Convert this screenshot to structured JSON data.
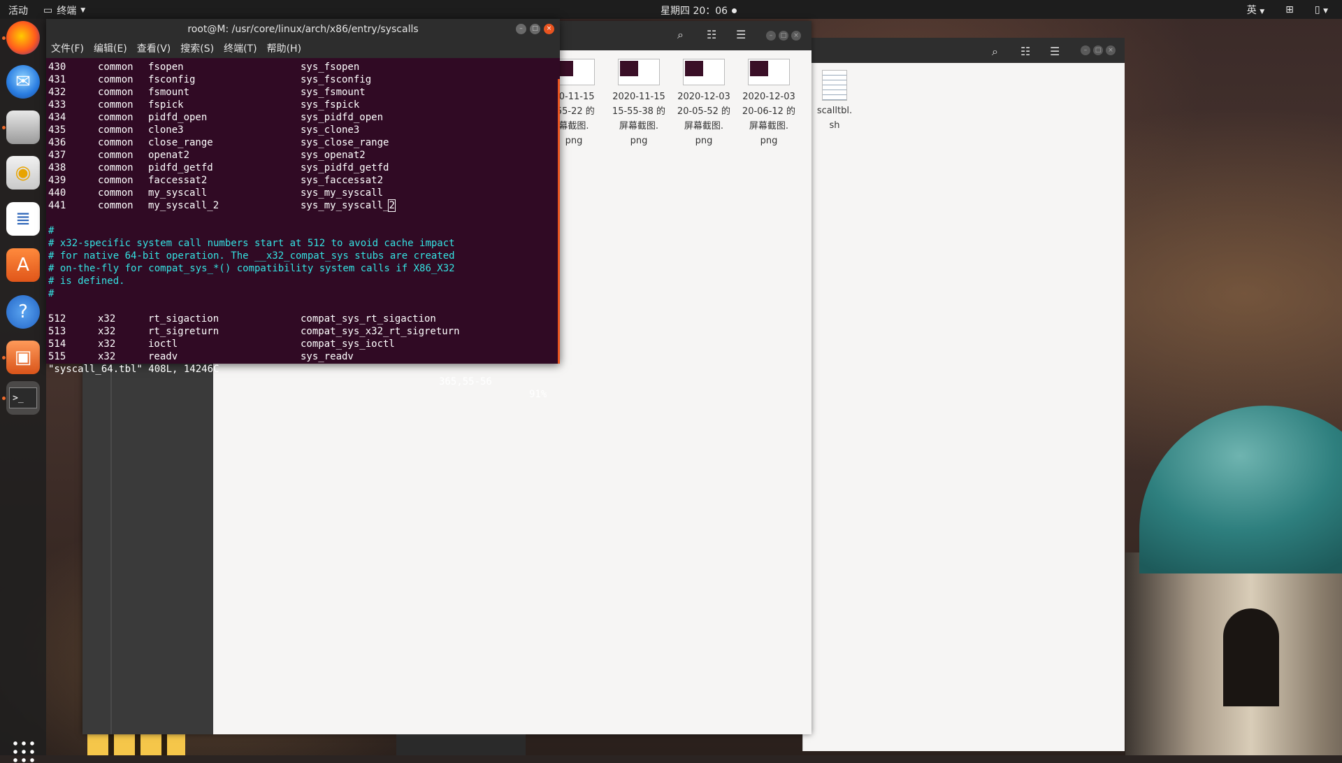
{
  "topbar": {
    "activities": "活动",
    "app_name": "终端",
    "clock": "星期四 20：06",
    "input_method": "英"
  },
  "dock": {
    "items": [
      {
        "name": "firefox",
        "icon": "firefox-icon"
      },
      {
        "name": "thunderbird",
        "icon": "mail-icon"
      },
      {
        "name": "files",
        "icon": "file-cabinet-icon"
      },
      {
        "name": "rhythmbox",
        "icon": "speaker-icon"
      },
      {
        "name": "writer",
        "icon": "document-icon"
      },
      {
        "name": "software",
        "icon": "shopping-bag-icon"
      },
      {
        "name": "help",
        "icon": "help-icon"
      },
      {
        "name": "screenshot",
        "icon": "camera-icon"
      },
      {
        "name": "terminal",
        "icon": "terminal-icon"
      }
    ]
  },
  "file_manager": {
    "files": [
      {
        "line1": "20-11-15",
        "line2": "-55-22 的",
        "line3": "幕截图.",
        "line4": "png"
      },
      {
        "line1": "2020-11-15",
        "line2": "15-55-38 的",
        "line3": "屏幕截图.",
        "line4": "png"
      },
      {
        "line1": "2020-12-03",
        "line2": "20-05-52 的",
        "line3": "屏幕截图.",
        "line4": "png"
      },
      {
        "line1": "2020-12-03",
        "line2": "20-06-12 的",
        "line3": "屏幕截图.",
        "line4": "png"
      }
    ],
    "script_file": {
      "line1": "scalltbl.",
      "line2": "sh"
    }
  },
  "terminal": {
    "title": "root@M: /usr/core/linux/arch/x86/entry/syscalls",
    "menu": [
      "文件(F)",
      "编辑(E)",
      "查看(V)",
      "搜索(S)",
      "终端(T)",
      "帮助(H)"
    ],
    "rows": [
      {
        "num": "430",
        "abi": "common",
        "name": "fsopen",
        "entry": "sys_fsopen"
      },
      {
        "num": "431",
        "abi": "common",
        "name": "fsconfig",
        "entry": "sys_fsconfig"
      },
      {
        "num": "432",
        "abi": "common",
        "name": "fsmount",
        "entry": "sys_fsmount"
      },
      {
        "num": "433",
        "abi": "common",
        "name": "fspick",
        "entry": "sys_fspick"
      },
      {
        "num": "434",
        "abi": "common",
        "name": "pidfd_open",
        "entry": "sys_pidfd_open"
      },
      {
        "num": "435",
        "abi": "common",
        "name": "clone3",
        "entry": "sys_clone3"
      },
      {
        "num": "436",
        "abi": "common",
        "name": "close_range",
        "entry": "sys_close_range"
      },
      {
        "num": "437",
        "abi": "common",
        "name": "openat2",
        "entry": "sys_openat2"
      },
      {
        "num": "438",
        "abi": "common",
        "name": "pidfd_getfd",
        "entry": "sys_pidfd_getfd"
      },
      {
        "num": "439",
        "abi": "common",
        "name": "faccessat2",
        "entry": "sys_faccessat2"
      },
      {
        "num": "440",
        "abi": "common",
        "name": "my_syscall",
        "entry": "sys_my_syscall"
      },
      {
        "num": "441",
        "abi": "common",
        "name": "my_syscall_2",
        "entry": "sys_my_syscall_",
        "cursor": "2"
      }
    ],
    "comments": [
      "#",
      "# x32-specific system call numbers start at 512 to avoid cache impact",
      "# for native 64-bit operation. The __x32_compat_sys stubs are created",
      "# on-the-fly for compat_sys_*() compatibility system calls if X86_X32",
      "# is defined.",
      "#"
    ],
    "x32_rows": [
      {
        "num": "512",
        "abi": "x32",
        "name": "rt_sigaction",
        "entry": "compat_sys_rt_sigaction"
      },
      {
        "num": "513",
        "abi": "x32",
        "name": "rt_sigreturn",
        "entry": "compat_sys_x32_rt_sigreturn"
      },
      {
        "num": "514",
        "abi": "x32",
        "name": "ioctl",
        "entry": "compat_sys_ioctl"
      },
      {
        "num": "515",
        "abi": "x32",
        "name": "readv",
        "entry": "sys_readv"
      }
    ],
    "status": {
      "file": "\"syscall_64.tbl\" 408L, 14246C",
      "position": "365,55-56",
      "percent": "91%"
    }
  },
  "colors": {
    "terminal_bg": "#300a24",
    "comment": "#34e2e2",
    "accent": "#e95420"
  }
}
